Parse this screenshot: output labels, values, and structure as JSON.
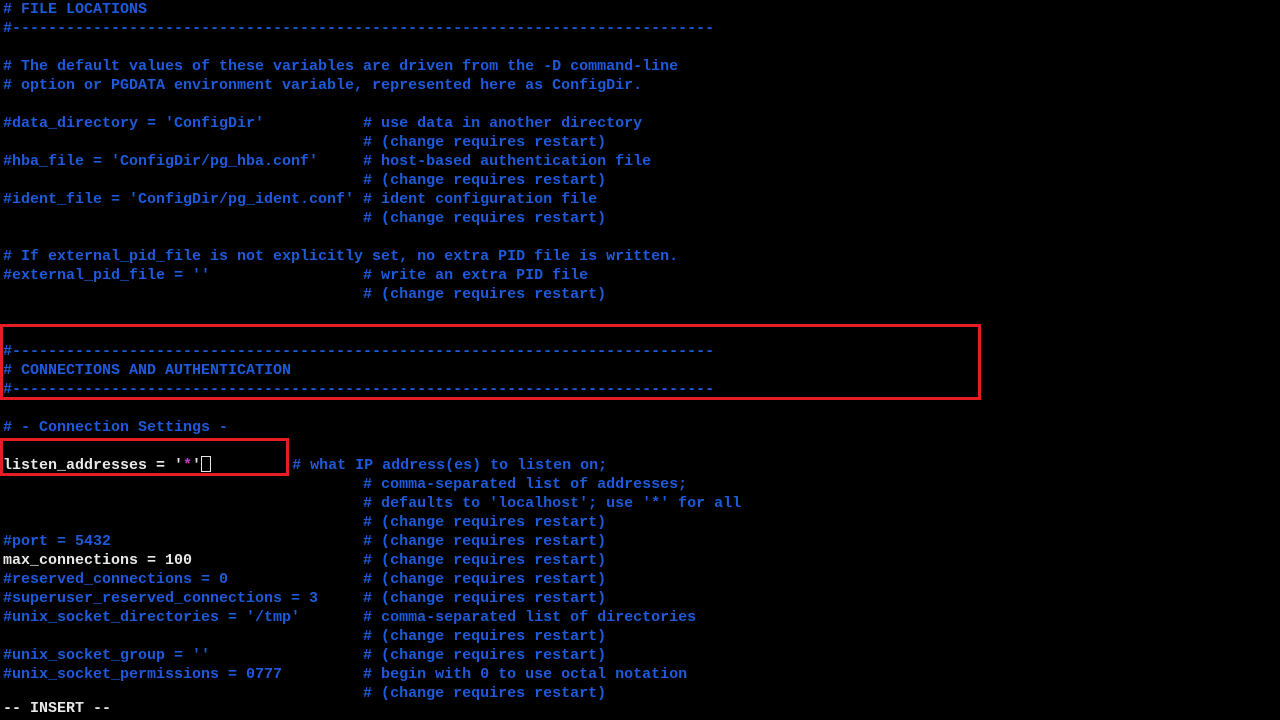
{
  "lines": {
    "l0": "# FILE LOCATIONS",
    "l1": "#------------------------------------------------------------------------------",
    "l2": "",
    "l3": "# The default values of these variables are driven from the -D command-line",
    "l4": "# option or PGDATA environment variable, represented here as ConfigDir.",
    "l5": "",
    "l6": "#data_directory = 'ConfigDir'           # use data in another directory",
    "l7": "                                        # (change requires restart)",
    "l8": "#hba_file = 'ConfigDir/pg_hba.conf'     # host-based authentication file",
    "l9": "                                        # (change requires restart)",
    "l10": "#ident_file = 'ConfigDir/pg_ident.conf' # ident configuration file",
    "l11": "                                        # (change requires restart)",
    "l12": "",
    "l13": "# If external_pid_file is not explicitly set, no extra PID file is written.",
    "l14": "#external_pid_file = ''                 # write an extra PID file",
    "l15": "                                        # (change requires restart)",
    "l16": "",
    "l17": "",
    "l18": "#------------------------------------------------------------------------------",
    "l19": "# CONNECTIONS AND AUTHENTICATION",
    "l20": "#------------------------------------------------------------------------------",
    "l21": "",
    "l22": "# - Connection Settings -",
    "l23": "",
    "l24a": "listen_addresses = '",
    "l24b": "*",
    "l24c": "'",
    "l24d": "         # what IP address(es) to listen on;",
    "l25": "                                        # comma-separated list of addresses;",
    "l26": "                                        # defaults to 'localhost'; use '*' for all",
    "l27": "                                        # (change requires restart)",
    "l28": "#port = 5432                            # (change requires restart)",
    "l29a": "max_connections = 100",
    "l29b": "                   # (change requires restart)",
    "l30": "#reserved_connections = 0               # (change requires restart)",
    "l31": "#superuser_reserved_connections = 3     # (change requires restart)",
    "l32": "#unix_socket_directories = '/tmp'       # comma-separated list of directories",
    "l33": "                                        # (change requires restart)",
    "l34": "#unix_socket_group = ''                 # (change requires restart)",
    "l35": "#unix_socket_permissions = 0777         # begin with 0 to use octal notation",
    "l36": "                                        # (change requires restart)"
  },
  "status": "-- INSERT --"
}
